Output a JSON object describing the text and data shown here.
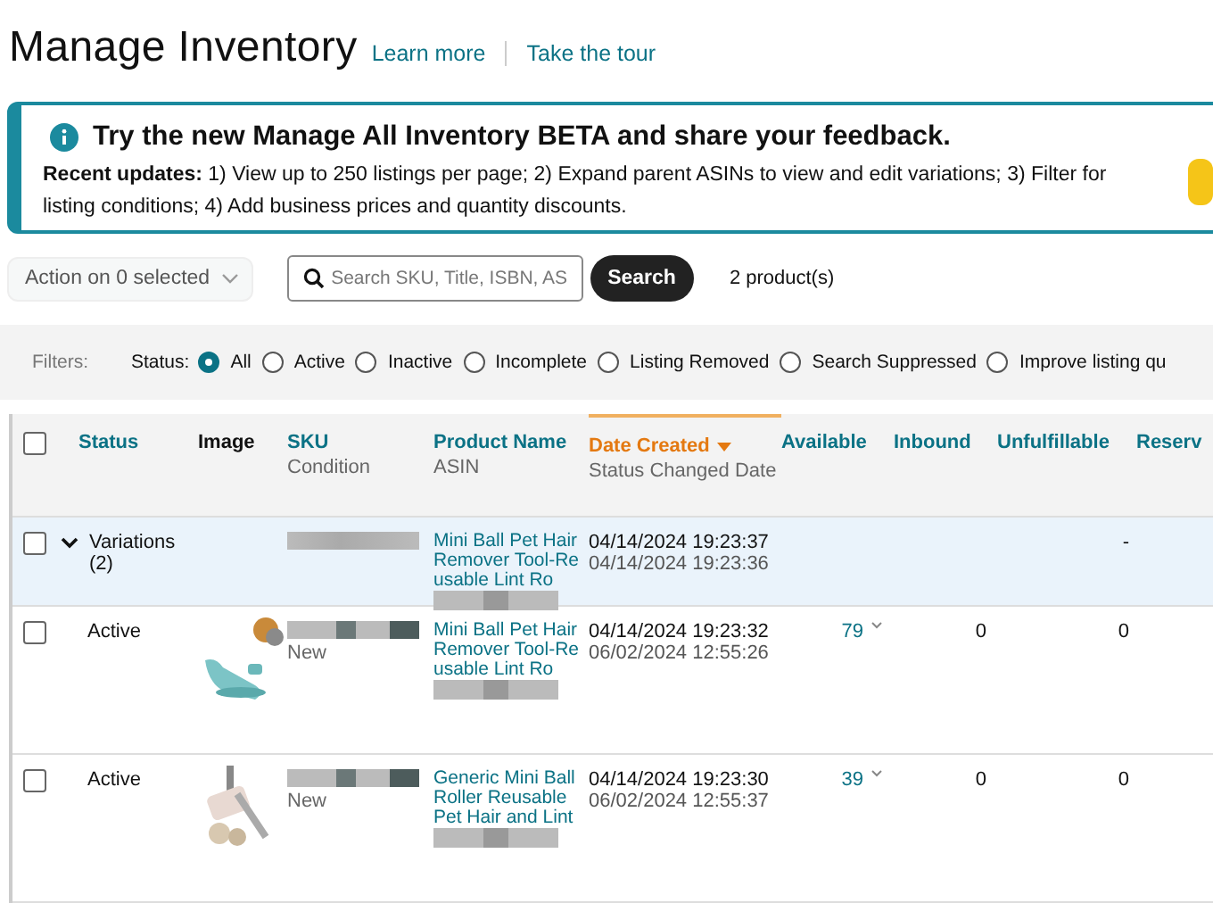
{
  "header": {
    "title": "Manage Inventory",
    "links": [
      "Learn more",
      "Take the tour"
    ]
  },
  "banner": {
    "heading": "Try the new Manage All Inventory BETA and share your feedback.",
    "text": "**Recent updates:** 1) View up to 250 listings per page; 2) Expand parent ASINs to view and edit variations; 3) Filter for listing conditions; 4) Add business prices and quantity discounts."
  },
  "toolbar": {
    "action": "Action on 0 selected",
    "search": {
      "placeholder": "Search SKU, Title, ISBN, AS"
    },
    "search_button": "Search",
    "count": "2 product(s)"
  },
  "filters": {
    "label": "Filters:",
    "status_label": "Status:",
    "options": [
      {
        "label": "All",
        "selected": true
      },
      {
        "label": "Active",
        "selected": false
      },
      {
        "label": "Inactive",
        "selected": false
      },
      {
        "label": "Incomplete",
        "selected": false
      },
      {
        "label": "Listing Removed",
        "selected": false
      },
      {
        "label": "Search Suppressed",
        "selected": false
      },
      {
        "label": "Improve listing qu",
        "selected": false
      }
    ]
  },
  "table": {
    "all_checked": false,
    "columns": [
      {
        "label": "Status",
        "sorted": false
      },
      {
        "label": "Image",
        "sorted": false
      },
      {
        "label": "SKU",
        "sub": "Condition",
        "sorted": false
      },
      {
        "label": "Product Name",
        "sub": "ASIN",
        "sorted": false
      },
      {
        "label": "Date Created",
        "sub": "Status Changed Date",
        "sorted": true
      },
      {
        "label": "Available",
        "sorted": false
      },
      {
        "label": "Inbound",
        "sorted": false
      },
      {
        "label": "Unfulfillable",
        "sorted": false
      },
      {
        "label": "Reserv",
        "sorted": false
      }
    ],
    "rows": [
      {
        "kind": "parent",
        "checked": false,
        "expanded": true,
        "status": "Variations (2)",
        "condition": null,
        "product": "Mini Ball Pet Hair Remover Tool-Reusable Lint Ro",
        "created": "04/14/2024 19:23:37",
        "changed": "04/14/2024 19:23:36",
        "available": null,
        "inbound": null,
        "unfulfillable": "-"
      },
      {
        "kind": "child",
        "checked": false,
        "status": "Active",
        "condition": "New",
        "product": "Mini Ball Pet Hair Remover Tool-Reusable Lint Ro",
        "created": "04/14/2024 19:23:32",
        "changed": "06/02/2024 12:55:26",
        "available": "79",
        "inbound": "0",
        "unfulfillable": "0"
      },
      {
        "kind": "child",
        "checked": false,
        "status": "Active",
        "condition": "New",
        "product": "Generic Mini Ball Roller Reusable Pet Hair and Lint",
        "created": "04/14/2024 19:23:30",
        "changed": "06/02/2024 12:55:37",
        "available": "39",
        "inbound": "0",
        "unfulfillable": "0"
      }
    ]
  }
}
